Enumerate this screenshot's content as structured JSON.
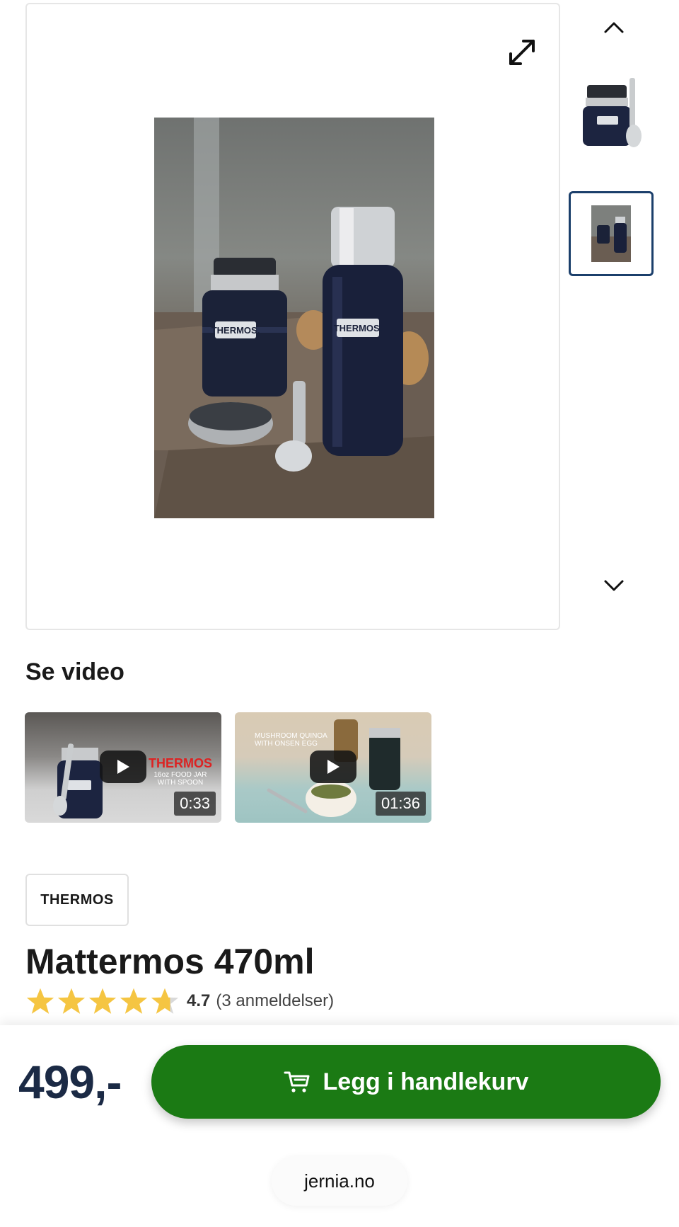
{
  "gallery": {
    "thumbnails": [
      {
        "alt": "Thermos food jar",
        "selected": false
      },
      {
        "alt": "Thermos set on wood",
        "selected": true
      }
    ]
  },
  "video_section": {
    "heading": "Se video",
    "videos": [
      {
        "duration": "0:33",
        "overlay_line1": "THERMOS",
        "overlay_line2": "16oz FOOD JAR",
        "overlay_line3": "WITH SPOON"
      },
      {
        "duration": "01:36",
        "overlay_line1": "MUSHROOM QUINOA",
        "overlay_line2": "WITH ONSEN EGG",
        "overlay_line3": ""
      }
    ]
  },
  "product": {
    "brand": "THERMOS",
    "title": "Mattermos 470ml",
    "rating_value": "4.7",
    "review_count": "(3 anmeldelser)",
    "rating": 4.7
  },
  "purchase": {
    "price": "499,-",
    "cart_label": "Legg i handlekurv"
  },
  "browser": {
    "domain": "jernia.no"
  },
  "colors": {
    "cart_green": "#1b7a14",
    "price_navy": "#1b2a45",
    "selected_border": "#1b3f6b",
    "star_gold": "#f5c542"
  }
}
